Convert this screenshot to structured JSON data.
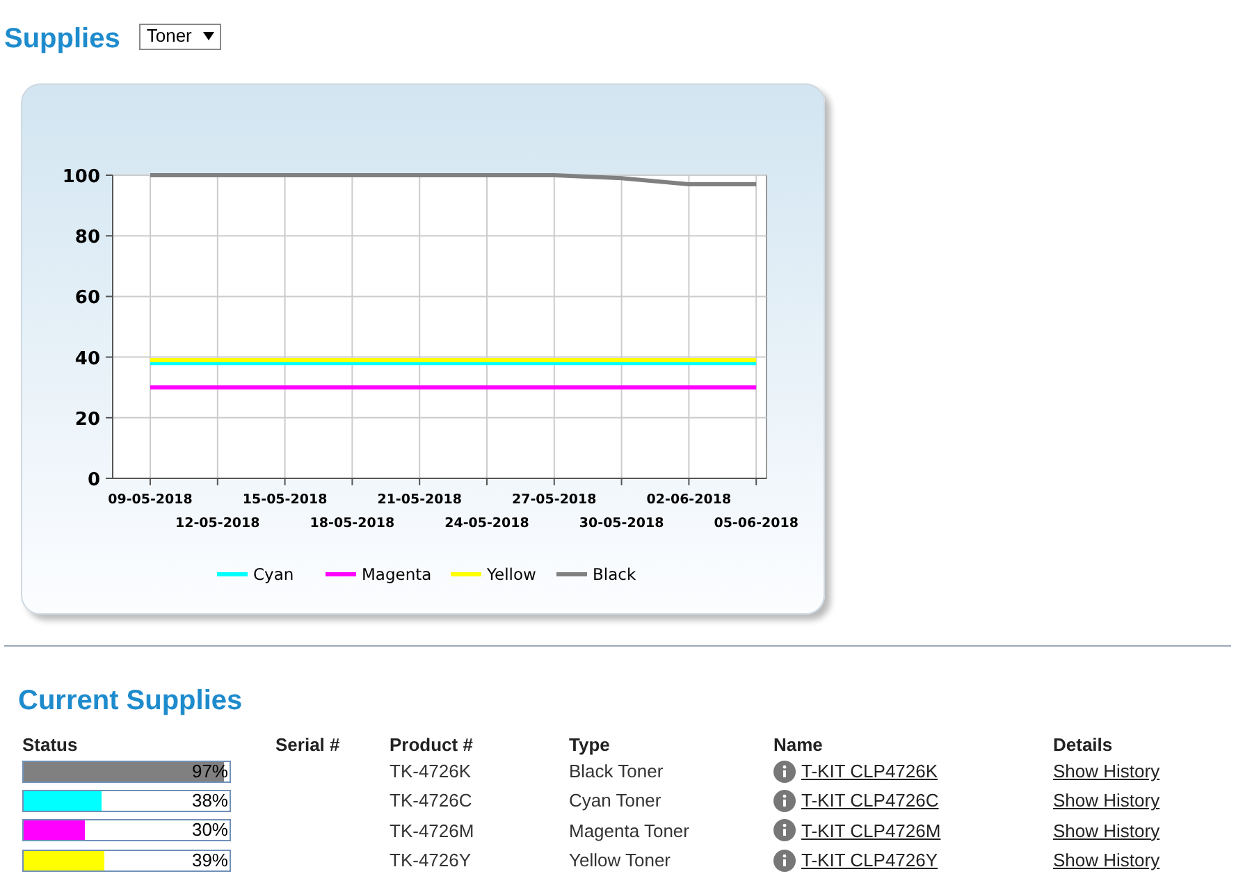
{
  "header": {
    "title": "Supplies",
    "filter": {
      "value": "Toner"
    }
  },
  "chart": {
    "chart_data": {
      "type": "line",
      "grid": true,
      "legend": "bottom",
      "categories": [
        "09-05-2018",
        "12-05-2018",
        "15-05-2018",
        "18-05-2018",
        "21-05-2018",
        "24-05-2018",
        "27-05-2018",
        "30-05-2018",
        "02-06-2018",
        "05-06-2018"
      ],
      "ylim": [
        0,
        100
      ],
      "yticks": [
        0,
        20,
        40,
        60,
        80,
        100
      ],
      "series": [
        {
          "name": "Cyan",
          "color": "#00ffff",
          "values": [
            38,
            38,
            38,
            38,
            38,
            38,
            38,
            38,
            38,
            38
          ]
        },
        {
          "name": "Magenta",
          "color": "#ff00ff",
          "values": [
            30,
            30,
            30,
            30,
            30,
            30,
            30,
            30,
            30,
            30
          ]
        },
        {
          "name": "Yellow",
          "color": "#ffff00",
          "values": [
            39,
            39,
            39,
            39,
            39,
            39,
            39,
            39,
            39,
            39
          ]
        },
        {
          "name": "Black",
          "color": "#808080",
          "values": [
            100,
            100,
            100,
            100,
            100,
            100,
            100,
            99,
            97,
            97
          ]
        }
      ]
    }
  },
  "current_supplies": {
    "title": "Current Supplies",
    "columns": [
      "Status",
      "Serial #",
      "Product #",
      "Type",
      "Name",
      "Details"
    ],
    "rows": [
      {
        "level": 0.97,
        "percent": "97%",
        "color": "#808080",
        "product": "TK-4726K",
        "type": "Black Toner",
        "name": "T-KIT CLP4726K",
        "details": "Show History"
      },
      {
        "level": 0.38,
        "percent": "38%",
        "color": "#00ffff",
        "product": "TK-4726C",
        "type": "Cyan Toner",
        "name": "T-KIT CLP4726C",
        "details": "Show History"
      },
      {
        "level": 0.3,
        "percent": "30%",
        "color": "#ff00ff",
        "product": "TK-4726M",
        "type": "Magenta Toner",
        "name": "T-KIT CLP4726M",
        "details": "Show History"
      },
      {
        "level": 0.39,
        "percent": "39%",
        "color": "#ffff00",
        "product": "TK-4726Y",
        "type": "Yellow Toner",
        "name": "T-KIT CLP4726Y",
        "details": "Show History"
      }
    ]
  }
}
